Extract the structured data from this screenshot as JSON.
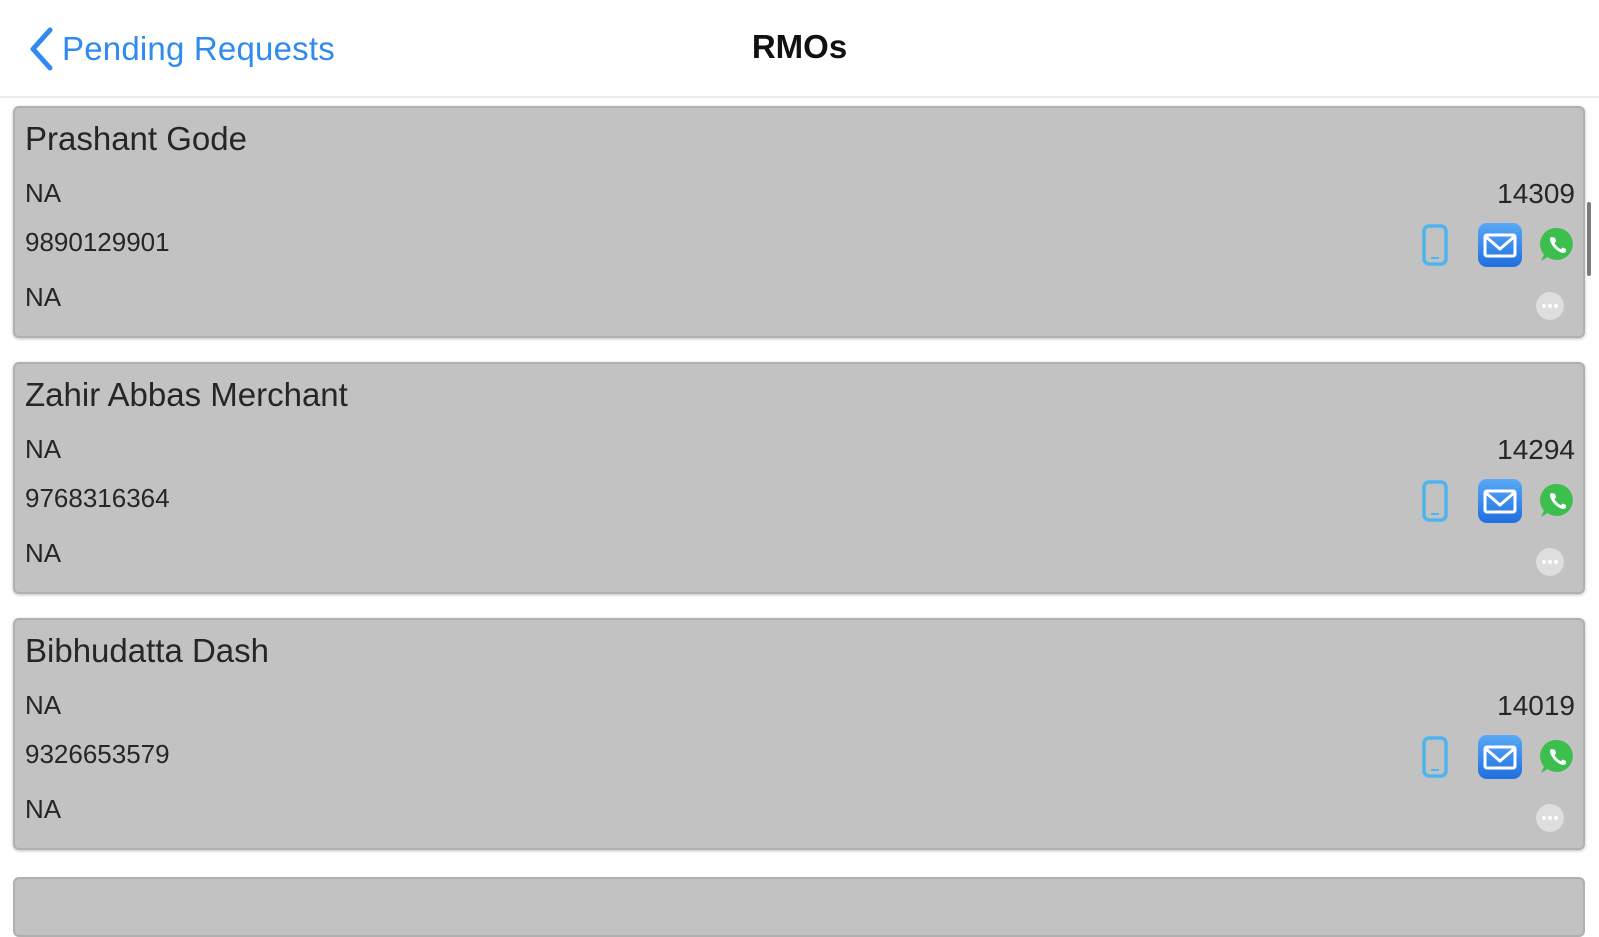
{
  "nav": {
    "back_label": "Pending Requests",
    "title": "RMOs"
  },
  "colors": {
    "accent": "#2f8bf0",
    "card_bg": "#c2c2c2",
    "phone": "#4fb3ee",
    "mail": "#2f86ef",
    "whatsapp": "#3cbf4e"
  },
  "icons": [
    "chevron-left-icon",
    "phone-icon",
    "mail-icon",
    "whatsapp-icon",
    "more-icon"
  ],
  "rmos": [
    {
      "name": "Prashant Gode",
      "field1": "NA",
      "id": "14309",
      "phone": "9890129901",
      "field3": "NA"
    },
    {
      "name": "Zahir Abbas Merchant",
      "field1": "NA",
      "id": "14294",
      "phone": "9768316364",
      "field3": "NA"
    },
    {
      "name": "Bibhudatta Dash",
      "field1": "NA",
      "id": "14019",
      "phone": "9326653579",
      "field3": "NA"
    }
  ]
}
